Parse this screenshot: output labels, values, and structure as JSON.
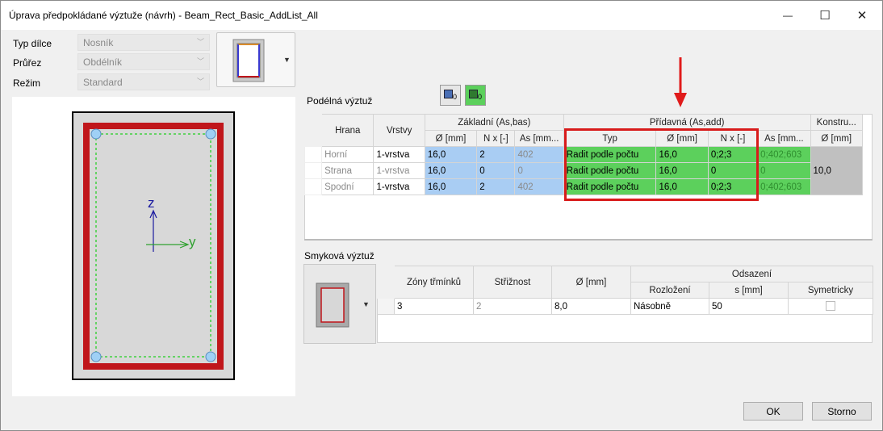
{
  "window": {
    "title": "Úprava předpokládané výztuže (návrh) - Beam_Rect_Basic_AddList_All",
    "minimize": "—",
    "maximize": "☐",
    "close": "✕"
  },
  "params": {
    "typ_dilce_label": "Typ dílce",
    "typ_dilce_value": "Nosník",
    "prurez_label": "Průřez",
    "prurez_value": "Obdélník",
    "rezim_label": "Režim",
    "rezim_value": "Standard"
  },
  "section": {
    "z_label": "z",
    "y_label": "y"
  },
  "longitudinal": {
    "title": "Podélná výztuž",
    "btn1_sub": "0",
    "btn2_sub": "0",
    "headers": {
      "hrana": "Hrana",
      "vrstvy": "Vrstvy",
      "zakladni": "Základní (As,bas)",
      "pridavna": "Přídavná (As,add)",
      "konstru": "Konstru...",
      "z_d": "Ø [mm]",
      "z_n": "N x [-]",
      "z_as": "As [mm...",
      "p_typ": "Typ",
      "p_d": "Ø [mm]",
      "p_n": "N x [-]",
      "p_as": "As [mm...",
      "k_d": "Ø [mm]"
    },
    "rows": [
      {
        "hrana": "Horní",
        "vrstvy": "1-vrstva",
        "z_d": "16,0",
        "z_n": "2",
        "z_as": "402",
        "p_typ": "Radit podle počtu",
        "p_d": "16,0",
        "p_n": "0;2;3",
        "p_as": "0;402;603"
      },
      {
        "hrana": "Strana",
        "vrstvy": "1-vrstva",
        "z_d": "16,0",
        "z_n": "0",
        "z_as": "0",
        "p_typ": "Radit podle počtu",
        "p_d": "16,0",
        "p_n": "0",
        "p_as": "0"
      },
      {
        "hrana": "Spodní",
        "vrstvy": "1-vrstva",
        "z_d": "16,0",
        "z_n": "2",
        "z_as": "402",
        "p_typ": "Radit podle počtu",
        "p_d": "16,0",
        "p_n": "0;2;3",
        "p_as": "0;402;603"
      }
    ],
    "konstru_value": "10,0"
  },
  "shear": {
    "title": "Smyková výztuž",
    "headers": {
      "zony": "Zóny třmínků",
      "strih": "Střižnost",
      "d": "Ø [mm]",
      "odsazeni": "Odsazení",
      "rozlozeni": "Rozložení",
      "s": "s [mm]",
      "sym": "Symetricky"
    },
    "row": {
      "zony": "3",
      "strih": "2",
      "d": "8,0",
      "rozlozeni": "Násobně",
      "s": "50"
    }
  },
  "buttons": {
    "ok": "OK",
    "storno": "Storno"
  },
  "colors": {
    "highlight": "#e01b1b",
    "green": "#5cd05c",
    "blue": "#a9cdf3",
    "rebar": "#c0161b"
  }
}
